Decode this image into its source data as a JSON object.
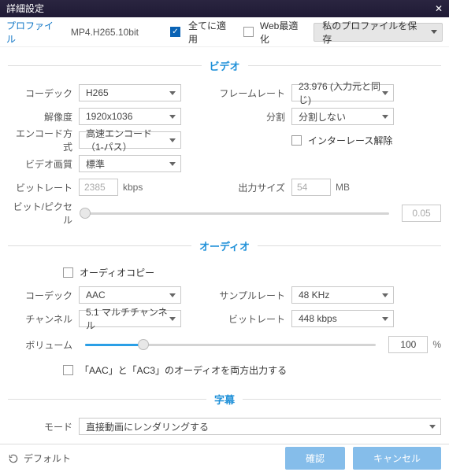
{
  "window": {
    "title": "詳細設定"
  },
  "header": {
    "profile_label": "プロファイル",
    "profile_value": "MP4.H265.10bit",
    "apply_all": {
      "label": "全てに適用",
      "checked": true
    },
    "web_opt": {
      "label": "Web最適化",
      "checked": false
    },
    "save_profile": "私のプロファイルを保存"
  },
  "sections": {
    "video": "ビデオ",
    "audio": "オーディオ",
    "subs": "字幕"
  },
  "video": {
    "codec": {
      "label": "コーデック",
      "value": "H265"
    },
    "resolution": {
      "label": "解像度",
      "value": "1920x1036"
    },
    "encode": {
      "label": "エンコード方式",
      "value": "高速エンコード（1-パス）"
    },
    "quality": {
      "label": "ビデオ画質",
      "value": "標準"
    },
    "bitrate": {
      "label": "ビットレート",
      "value": "2385",
      "unit": "kbps"
    },
    "framerate": {
      "label": "フレームレート",
      "value": "23.976 (入力元と同じ)"
    },
    "split": {
      "label": "分割",
      "value": "分割しない"
    },
    "deinterlace": {
      "label": "インターレース解除",
      "checked": false
    },
    "output_size": {
      "label": "出力サイズ",
      "value": "54",
      "unit": "MB"
    },
    "bpp": {
      "label": "ビット/ピクセル",
      "value": "0.05"
    }
  },
  "audio": {
    "copy": {
      "label": "オーディオコピー",
      "checked": false
    },
    "codec": {
      "label": "コーデック",
      "value": "AAC"
    },
    "channel": {
      "label": "チャンネル",
      "value": "5.1 マルチチャンネル"
    },
    "samplerate": {
      "label": "サンプルレート",
      "value": "48 KHz"
    },
    "bitrate": {
      "label": "ビットレート",
      "value": "448 kbps"
    },
    "volume": {
      "label": "ボリューム",
      "value": "100",
      "unit": "%"
    },
    "dual_output": {
      "label": "「AAC」と「AC3」のオーディオを両方出力する",
      "checked": false
    }
  },
  "subs": {
    "mode": {
      "label": "モード",
      "value": "直接動画にレンダリングする"
    }
  },
  "footer": {
    "default": "デフォルト",
    "ok": "確認",
    "cancel": "キャンセル"
  }
}
